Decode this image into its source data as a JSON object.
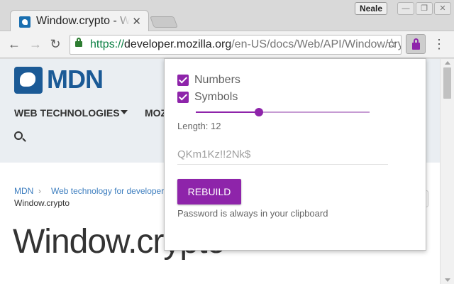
{
  "window": {
    "profile_name": "Neale",
    "minimize_glyph": "—",
    "restore_glyph": "❐",
    "close_glyph": "✕"
  },
  "tab": {
    "title": "Window.crypto - Web APIs | MDN",
    "close_glyph": "✕",
    "favicon": "mdn-favicon"
  },
  "toolbar": {
    "back_glyph": "←",
    "forward_glyph": "→",
    "reload_glyph": "↻",
    "url_scheme": "https://",
    "url_host": "developer.mozilla.org",
    "url_path": "/en-US/docs/Web/API/Window/crypto",
    "star_glyph": "☆",
    "menu_glyph": "⋮"
  },
  "page": {
    "logo_text": "MDN",
    "nav_web_technologies": "WEB TECHNOLOGIES",
    "nav_mozilla": "MOZ",
    "breadcrumb_root": "MDN",
    "breadcrumb_sep": "›",
    "breadcrumb_section": "Web technology for developers",
    "breadcrumb_current": "Window.crypto",
    "title": "Window.crypto"
  },
  "popup": {
    "option_numbers": "Numbers",
    "option_symbols": "Symbols",
    "numbers_checked": true,
    "symbols_checked": true,
    "length_label": "Length: 12",
    "length_value": 12,
    "slider_fraction": 0.364,
    "password": "QKm1Kz!!2Nk$",
    "rebuild_label": "REBUILD",
    "hint": "Password is always in your clipboard",
    "accent_color": "#8e24aa"
  }
}
